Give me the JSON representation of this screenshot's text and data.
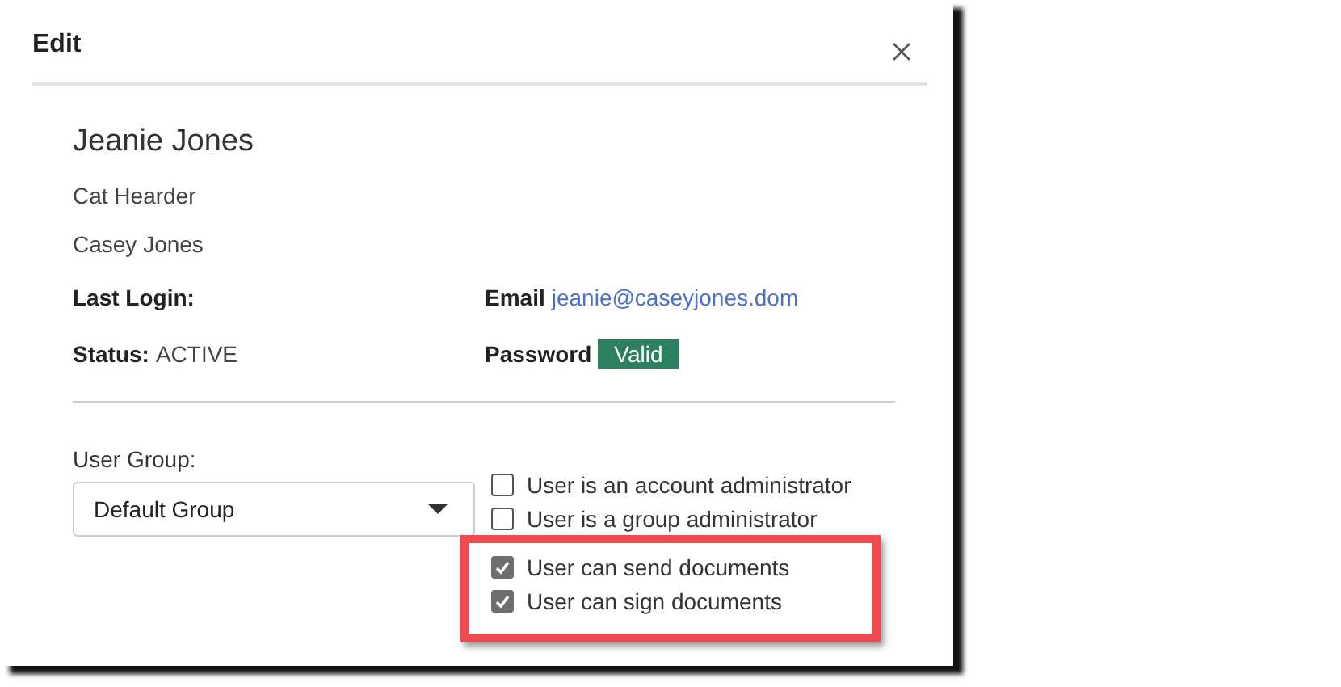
{
  "dialog": {
    "title": "Edit"
  },
  "user": {
    "name": "Jeanie Jones",
    "title": "Cat Hearder",
    "company": "Casey Jones"
  },
  "details": [
    {
      "label": "Last Login:"
    },
    {
      "label": "Email",
      "value": "jeanie@caseyjones.dom",
      "kind": "link"
    },
    {
      "label": "Status:",
      "value": "ACTIVE",
      "kind": "text"
    },
    {
      "label": "Password",
      "value": "Valid",
      "kind": "badge"
    }
  ],
  "user_group": {
    "label": "User Group:",
    "value": "Default Group"
  },
  "permissions": [
    {
      "label": "User is an account administrator",
      "checked": false,
      "highlighted": false
    },
    {
      "label": "User is a group administrator",
      "checked": false,
      "highlighted": false
    },
    {
      "label": "User can send documents",
      "checked": true,
      "highlighted": true
    },
    {
      "label": "User can sign documents",
      "checked": true,
      "highlighted": true
    }
  ]
}
